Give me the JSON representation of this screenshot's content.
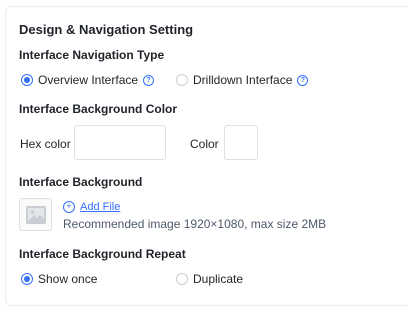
{
  "panel": {
    "title": "Design & Navigation Setting"
  },
  "navigation_type": {
    "label": "Interface Navigation Type",
    "options": [
      {
        "label": "Overview Interface",
        "selected": true,
        "has_help": true
      },
      {
        "label": "Drilldown Interface",
        "selected": false,
        "has_help": true
      }
    ]
  },
  "background_color": {
    "label": "Interface Background Color",
    "hex_label": "Hex color",
    "hex_value": "",
    "color_label": "Color"
  },
  "background": {
    "label": "Interface Background",
    "add_file_label": "Add File",
    "hint": "Recommended image 1920×1080, max size 2MB",
    "thumbnail_icon": "image-placeholder-icon"
  },
  "background_repeat": {
    "label": "Interface Background Repeat",
    "options": [
      {
        "label": "Show once",
        "selected": true
      },
      {
        "label": "Duplicate",
        "selected": false
      }
    ]
  },
  "colors": {
    "accent": "#3370ff",
    "text": "#1f2329",
    "border": "#dee0e3"
  },
  "icons": {
    "help": "question-circle-icon",
    "add": "plus-circle-icon"
  }
}
